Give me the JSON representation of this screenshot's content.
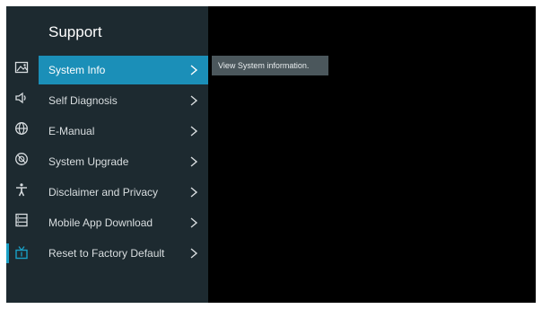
{
  "menu": {
    "title": "Support",
    "items": [
      {
        "label": "System Info",
        "selected": true
      },
      {
        "label": "Self Diagnosis"
      },
      {
        "label": "E-Manual"
      },
      {
        "label": "System Upgrade"
      },
      {
        "label": "Disclaimer and Privacy"
      },
      {
        "label": "Mobile App Download"
      },
      {
        "label": "Reset to Factory Default"
      }
    ]
  },
  "rail_icons": [
    "picture-icon",
    "sound-icon",
    "network-icon",
    "system-icon",
    "accessibility-icon",
    "apps-icon",
    "support-icon"
  ],
  "tooltip": {
    "text": "View System information."
  },
  "colors": {
    "accent": "#1b8fb8",
    "panel": "#1d2a30",
    "tooltip": "#4b575c"
  }
}
